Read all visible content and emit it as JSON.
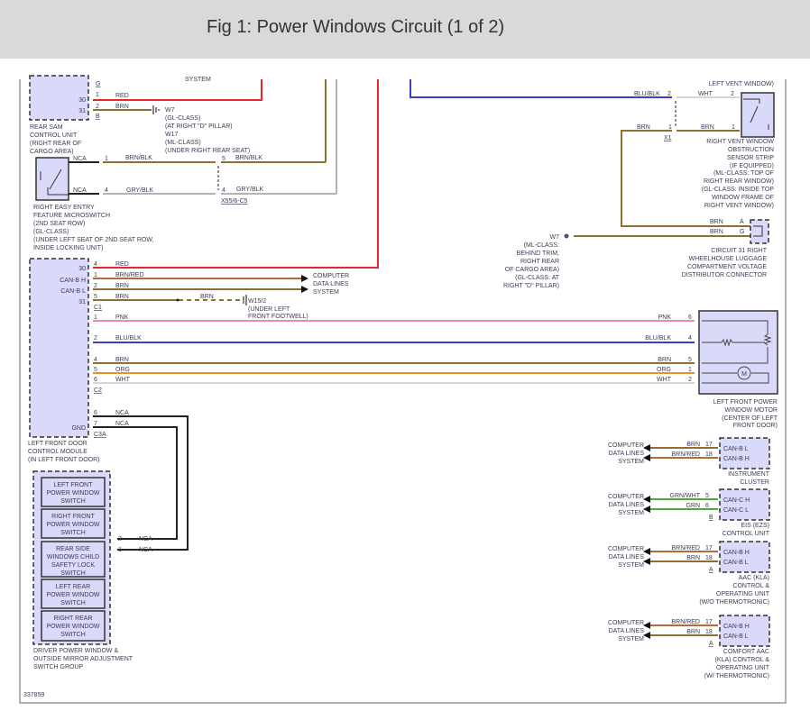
{
  "title": "Fig 1: Power Windows Circuit (1 of 2)",
  "figure_number": "337859",
  "colors": {
    "red": "#e8262b",
    "brn": "#8c7031",
    "blu": "#3c3ccf",
    "pnk": "#f487a6",
    "org": "#f08c22",
    "wht": "#d6d6d6",
    "gry": "#b3b3b3",
    "grn": "#4fa83a",
    "brnred": "#b8683a",
    "nca": "#222222",
    "module": "#d9d9f9"
  },
  "partial_top": {
    "system_cut": "SYSTEM",
    "left_vent": "LEFT VENT WINDOW)"
  },
  "rear_sam": {
    "pins": [
      "G",
      "30",
      "31"
    ],
    "conn_pins": [
      "1",
      "2"
    ],
    "conn_id": "B",
    "label": [
      "REAR SAM",
      "CONTROL UNIT",
      "(RIGHT REAR OF",
      "CARGO AREA)"
    ],
    "wires": [
      "RED",
      "BRN"
    ],
    "ground": [
      "W7",
      "(GL-CLASS)",
      "(AT RIGHT \"D\" PILLAR)",
      "W17",
      "(ML-CLASS)",
      "(UNDER RIGHT REAR SEAT)"
    ]
  },
  "microswitch": {
    "label": [
      "RIGHT EASY ENTRY",
      "FEATURE MICROSWITCH",
      "(2ND SEAT ROW)",
      "(GL-CLASS)",
      "(UNDER LEFT SEAT OF 2ND SEAT ROW,",
      "INSIDE LOCKING UNIT)"
    ],
    "wires": [
      {
        "nca": "NCA",
        "pin": "1",
        "color": "BRN/BLK",
        "pin2": "5",
        "color2": "BRN/BLK"
      },
      {
        "nca": "NCA",
        "pin": "4",
        "color": "GRY/BLK",
        "pin2": "4",
        "color2": "GRY/BLK"
      }
    ],
    "connector": "X55/6-C5"
  },
  "vent_sensor": {
    "label": [
      "RIGHT VENT WINDOW",
      "OBSTRUCTION",
      "SENSOR STRIP",
      "(IF EQUIPPED)",
      "(ML-CLASS: TOP OF",
      "RIGHT REAR WINDOW)",
      "(GL-CLASS: INSIDE TOP",
      "WINDOW FRAME OF",
      "RIGHT VENT WINDOW)"
    ],
    "wires": [
      {
        "c1": "BLU/BLK",
        "p1": "2",
        "c2": "WHT",
        "p2": "2"
      },
      {
        "c1": "BRN",
        "p1": "1",
        "c2": "BRN",
        "p2": "1"
      }
    ],
    "connector": "X1"
  },
  "circuit31": {
    "label": [
      "CIRCUIT 31 RIGHT",
      "WHEELHOUSE LUGGAGE",
      "COMPARTMENT VOLTAGE",
      "DISTRIBUTOR CONNECTOR"
    ],
    "wires": [
      {
        "color": "BRN",
        "pin": "A"
      },
      {
        "color": "BRN",
        "pin": "G"
      }
    ],
    "ground": [
      "W7",
      "(ML-CLASS:",
      "BEHIND TRIM,",
      "RIGHT REAR",
      "OF CARGO AREA)",
      "(GL-CLASS: AT",
      "RIGHT \"D\" PILLAR)"
    ]
  },
  "lfdcm": {
    "label": [
      "LEFT FRONT DOOR",
      "CONTROL MODULE",
      "(IN LEFT FRONT DOOR)"
    ],
    "pins": [
      "30",
      "CAN-B H",
      "CAN-B L",
      "31",
      "GND"
    ],
    "c1": [
      {
        "pin": "4",
        "color": "RED"
      },
      {
        "pin": "1",
        "color": "BRN/RED"
      },
      {
        "pin": "2",
        "color": "BRN"
      },
      {
        "pin": "5",
        "color": "BRN"
      }
    ],
    "c1_id": "C1",
    "splice_color": "BRN",
    "ground": [
      "W15/2",
      "(UNDER LEFT",
      "FRONT FOOTWELL)"
    ],
    "data_lines": [
      "COMPUTER",
      "DATA LINES",
      "SYSTEM"
    ],
    "c2": [
      {
        "pin": "1",
        "color": "PNK"
      },
      {
        "pin": "2",
        "color": "BLU/BLK"
      },
      {
        "pin": "4",
        "color": "BRN"
      },
      {
        "pin": "5",
        "color": "ORG"
      },
      {
        "pin": "6",
        "color": "WHT"
      }
    ],
    "c2_id": "C2",
    "c3a": [
      {
        "pin": "6",
        "color": "NCA"
      },
      {
        "pin": "7",
        "color": "NCA"
      }
    ],
    "c3a_id": "C3A"
  },
  "motor": {
    "label": [
      "LEFT FRONT POWER",
      "WINDOW MOTOR",
      "(CENTER OF LEFT",
      "FRONT DOOR)"
    ],
    "pins": [
      {
        "color": "PNK",
        "pin": "6"
      },
      {
        "color": "BLU/BLK",
        "pin": "4"
      },
      {
        "color": "BRN",
        "pin": "5"
      },
      {
        "color": "ORG",
        "pin": "1"
      },
      {
        "color": "WHT",
        "pin": "2"
      }
    ],
    "motor_symbol": "M"
  },
  "switch_group": {
    "label": [
      "DRIVER POWER WINDOW &",
      "OUTSIDE MIRROR ADJUSTMENT",
      "SWITCH GROUP"
    ],
    "switches": [
      [
        "LEFT FRONT",
        "POWER WINDOW",
        "SWITCH"
      ],
      [
        "RIGHT FRONT",
        "POWER WINDOW",
        "SWITCH"
      ],
      [
        "REAR SIDE",
        "WINDOWS CHILD",
        "SAFETY LOCK",
        "SWITCH"
      ],
      [
        "LEFT REAR",
        "POWER WINDOW",
        "SWITCH"
      ],
      [
        "RIGHT REAR",
        "POWER WINDOW",
        "SWITCH"
      ]
    ],
    "wires": [
      {
        "pin": "2",
        "color": "NCA"
      },
      {
        "pin": "1",
        "color": "NCA"
      }
    ]
  },
  "can_modules": [
    {
      "name": [
        "INSTRUMENT",
        "CLUSTER"
      ],
      "pins": [
        {
          "color": "BRN",
          "pin": "17",
          "sig": "CAN-B L"
        },
        {
          "color": "BRN/RED",
          "pin": "18",
          "sig": "CAN-B H"
        }
      ],
      "conn": ""
    },
    {
      "name": [
        "EIS (EZS)",
        "CONTROL UNIT"
      ],
      "pins": [
        {
          "color": "GRN/WHT",
          "pin": "5",
          "sig": "CAN-C H"
        },
        {
          "color": "GRN",
          "pin": "6",
          "sig": "CAN-C L"
        }
      ],
      "conn": "B"
    },
    {
      "name": [
        "AAC (KLA)",
        "CONTROL &",
        "OPERATING UNIT",
        "(W/O THERMOTRONIC)"
      ],
      "pins": [
        {
          "color": "BRN/RED",
          "pin": "17",
          "sig": "CAN-B H"
        },
        {
          "color": "BRN",
          "pin": "18",
          "sig": "CAN-B L"
        }
      ],
      "conn": "A"
    },
    {
      "name": [
        "COMFORT AAC",
        "(KLA) CONTROL &",
        "OPERATING UNIT",
        "(W/ THERMOTRONIC)"
      ],
      "pins": [
        {
          "color": "BRN/RED",
          "pin": "17",
          "sig": "CAN-B H"
        },
        {
          "color": "BRN",
          "pin": "18",
          "sig": "CAN-B L"
        }
      ],
      "conn": "A"
    }
  ]
}
